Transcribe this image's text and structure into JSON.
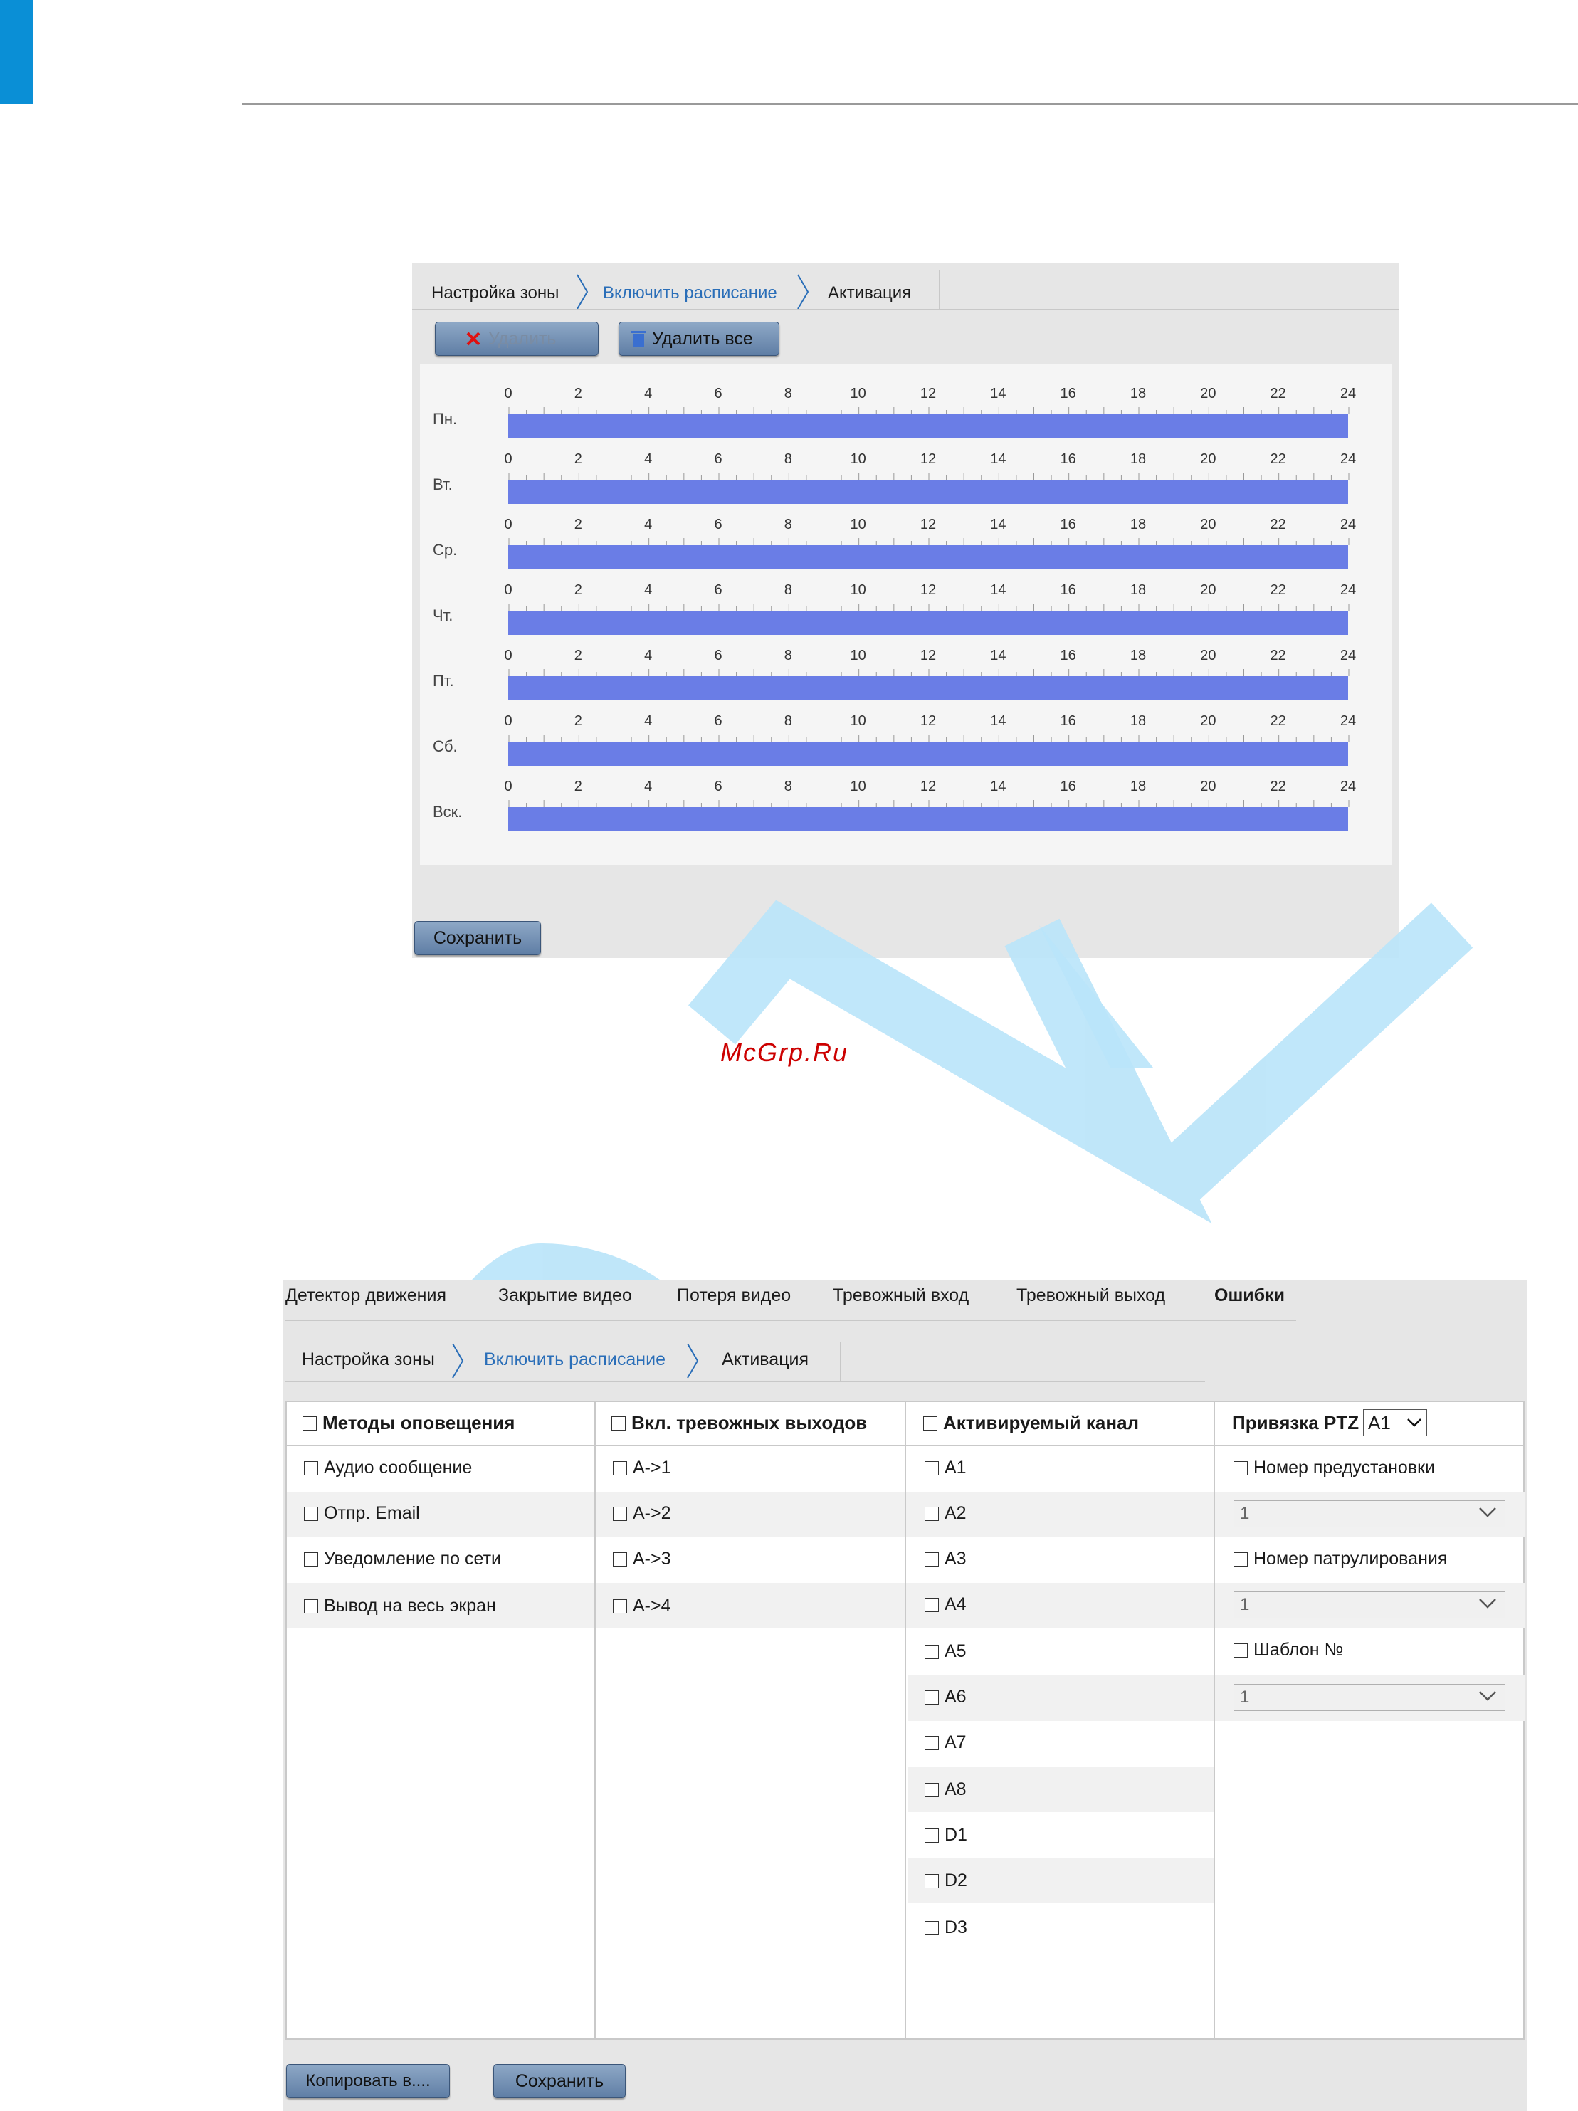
{
  "header": {
    "accent_color": "#0a8fd6"
  },
  "watermark": {
    "text": "McGrp.Ru",
    "color": "#cc0000",
    "shape_color": "#b9e4f9"
  },
  "schedule_panel": {
    "tabs": [
      "Настройка зоны",
      "Включить расписание",
      "Активация"
    ],
    "active_tab": "Включить расписание",
    "delete_label": "Удалить",
    "delete_all_label": "Удалить все",
    "hours": [
      "0",
      "2",
      "4",
      "6",
      "8",
      "10",
      "12",
      "14",
      "16",
      "18",
      "20",
      "22",
      "24"
    ],
    "days": [
      "Пн.",
      "Вт.",
      "Ср.",
      "Чт.",
      "Пт.",
      "Сб.",
      "Вск."
    ],
    "bar_color": "#6a7de6",
    "save_label": "Сохранить"
  },
  "activation_panel": {
    "nav_tabs": [
      "Детектор движения",
      "Закрытие видео",
      "Потеря видео",
      "Тревожный вход",
      "Тревожный выход",
      "Ошибки"
    ],
    "active_nav_tab": "Ошибки",
    "sub_tabs": [
      "Настройка зоны",
      "Включить расписание",
      "Активация"
    ],
    "active_sub_tab": "Включить расписание",
    "columns": {
      "methods": {
        "header": "Методы оповещения",
        "items": [
          "Аудио сообщение",
          "Отпр. Email",
          "Уведомление по сети",
          "Вывод на весь экран"
        ]
      },
      "alarm_outputs": {
        "header": "Вкл. тревожных выходов",
        "items": [
          "A->1",
          "A->2",
          "A->3",
          "A->4"
        ]
      },
      "channels": {
        "header": "Активируемый канал",
        "items": [
          "A1",
          "A2",
          "A3",
          "A4",
          "A5",
          "A6",
          "A7",
          "A8",
          "D1",
          "D2",
          "D3"
        ]
      },
      "ptz": {
        "header": "Привязка PTZ",
        "channel_value": "A1",
        "preset_label": "Номер предустановки",
        "preset_value": "1",
        "patrol_label": "Номер патрулирования",
        "patrol_value": "1",
        "template_label": "Шаблон №",
        "template_value": "1"
      }
    },
    "copy_label": "Копировать в....",
    "save_label": "Сохранить"
  }
}
